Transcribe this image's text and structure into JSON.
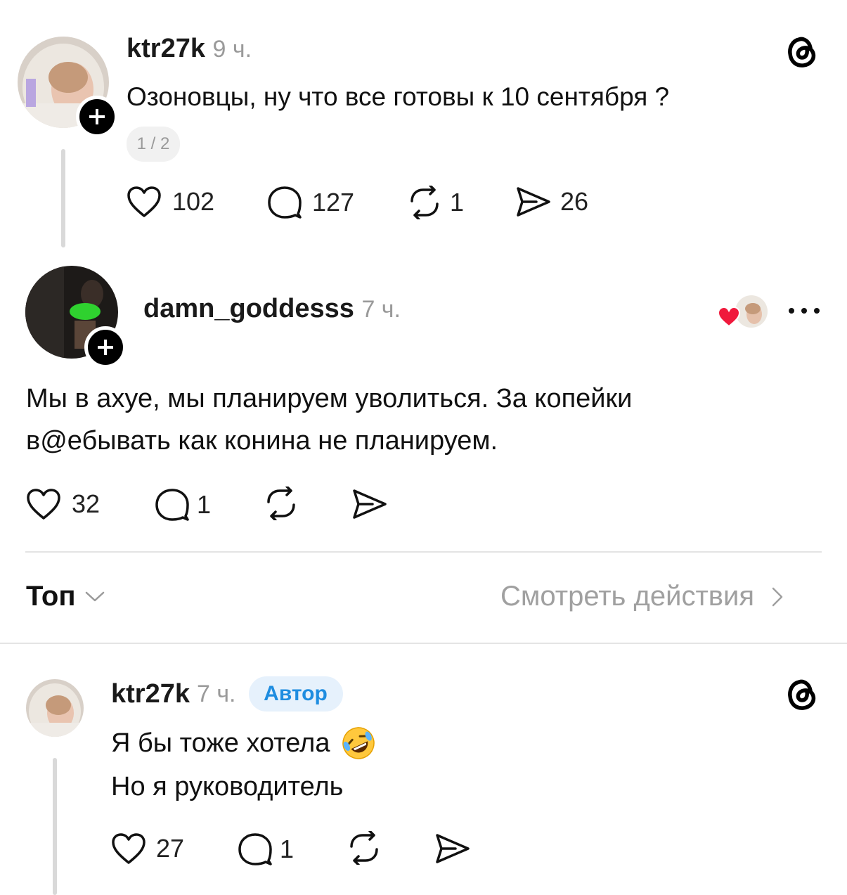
{
  "post": {
    "username": "ktr27k",
    "time": "9 ч.",
    "text": "Озоновцы, ну что все готовы к 10 сентября ?",
    "page_indicator": "1 / 2",
    "likes": "102",
    "comments": "127",
    "reposts": "1",
    "shares": "26",
    "icon": "threads-logo-icon"
  },
  "reply1": {
    "username": "damn_goddesss",
    "time": "7 ч.",
    "text_line1": "Мы в ахуе, мы планируем уволиться. За копейки",
    "text_line2": "в@ебывать как конина не планируем.",
    "likes": "32",
    "comments": "1"
  },
  "filter": {
    "sort_label": "Топ",
    "activity_label": "Смотреть действия"
  },
  "reply2": {
    "username": "ktr27k",
    "time": "7 ч.",
    "author_badge": "Автор",
    "text_line1": "Я бы тоже хотела",
    "emoji": "🤣",
    "text_line2": "Но я руководитель",
    "likes": "27",
    "comments": "1"
  },
  "colors": {
    "accent_blue": "#1f8de0",
    "heart_red": "#f0193c",
    "divider": "#e4e4e4"
  }
}
